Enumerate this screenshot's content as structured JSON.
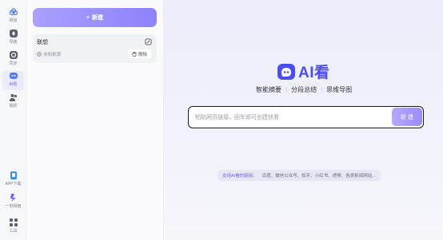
{
  "rail": {
    "items": [
      {
        "label": "频道",
        "icon": "cloud-icon"
      },
      {
        "label": "导航",
        "icon": "compass-icon"
      },
      {
        "label": "同步",
        "icon": "sync-icon"
      },
      {
        "label": "AI看",
        "icon": "ai-look-icon"
      },
      {
        "label": "我的",
        "icon": "user-icon"
      }
    ],
    "bottom": [
      {
        "label": "APP下载",
        "icon": "app-download-icon"
      },
      {
        "label": "一刻相册",
        "icon": "album-icon"
      },
      {
        "label": "工具",
        "icon": "tools-icon"
      }
    ],
    "active_index": 3
  },
  "list": {
    "new_button": "新建",
    "new_icon": "+",
    "card": {
      "title": "联想",
      "source": "未知来源",
      "delete": "删除"
    }
  },
  "main": {
    "logo_text": "AI看",
    "tagline": [
      "智能摘要",
      "分段总结",
      "思维导图"
    ],
    "search": {
      "placeholder": "粘贴网页链接，回车即可创建快看",
      "button": "新 建"
    },
    "support": {
      "label": "支持AI看的链接：",
      "sites": [
        "百度、",
        "微信公众号、",
        "知乎、",
        "小红书、",
        "虎嗅、",
        "各类新闻网站..."
      ]
    }
  },
  "colors": {
    "accent": "#6a5cff",
    "logo": "#4d4cf0",
    "button_start": "#a9a0ff",
    "button_end": "#8e82fb"
  }
}
